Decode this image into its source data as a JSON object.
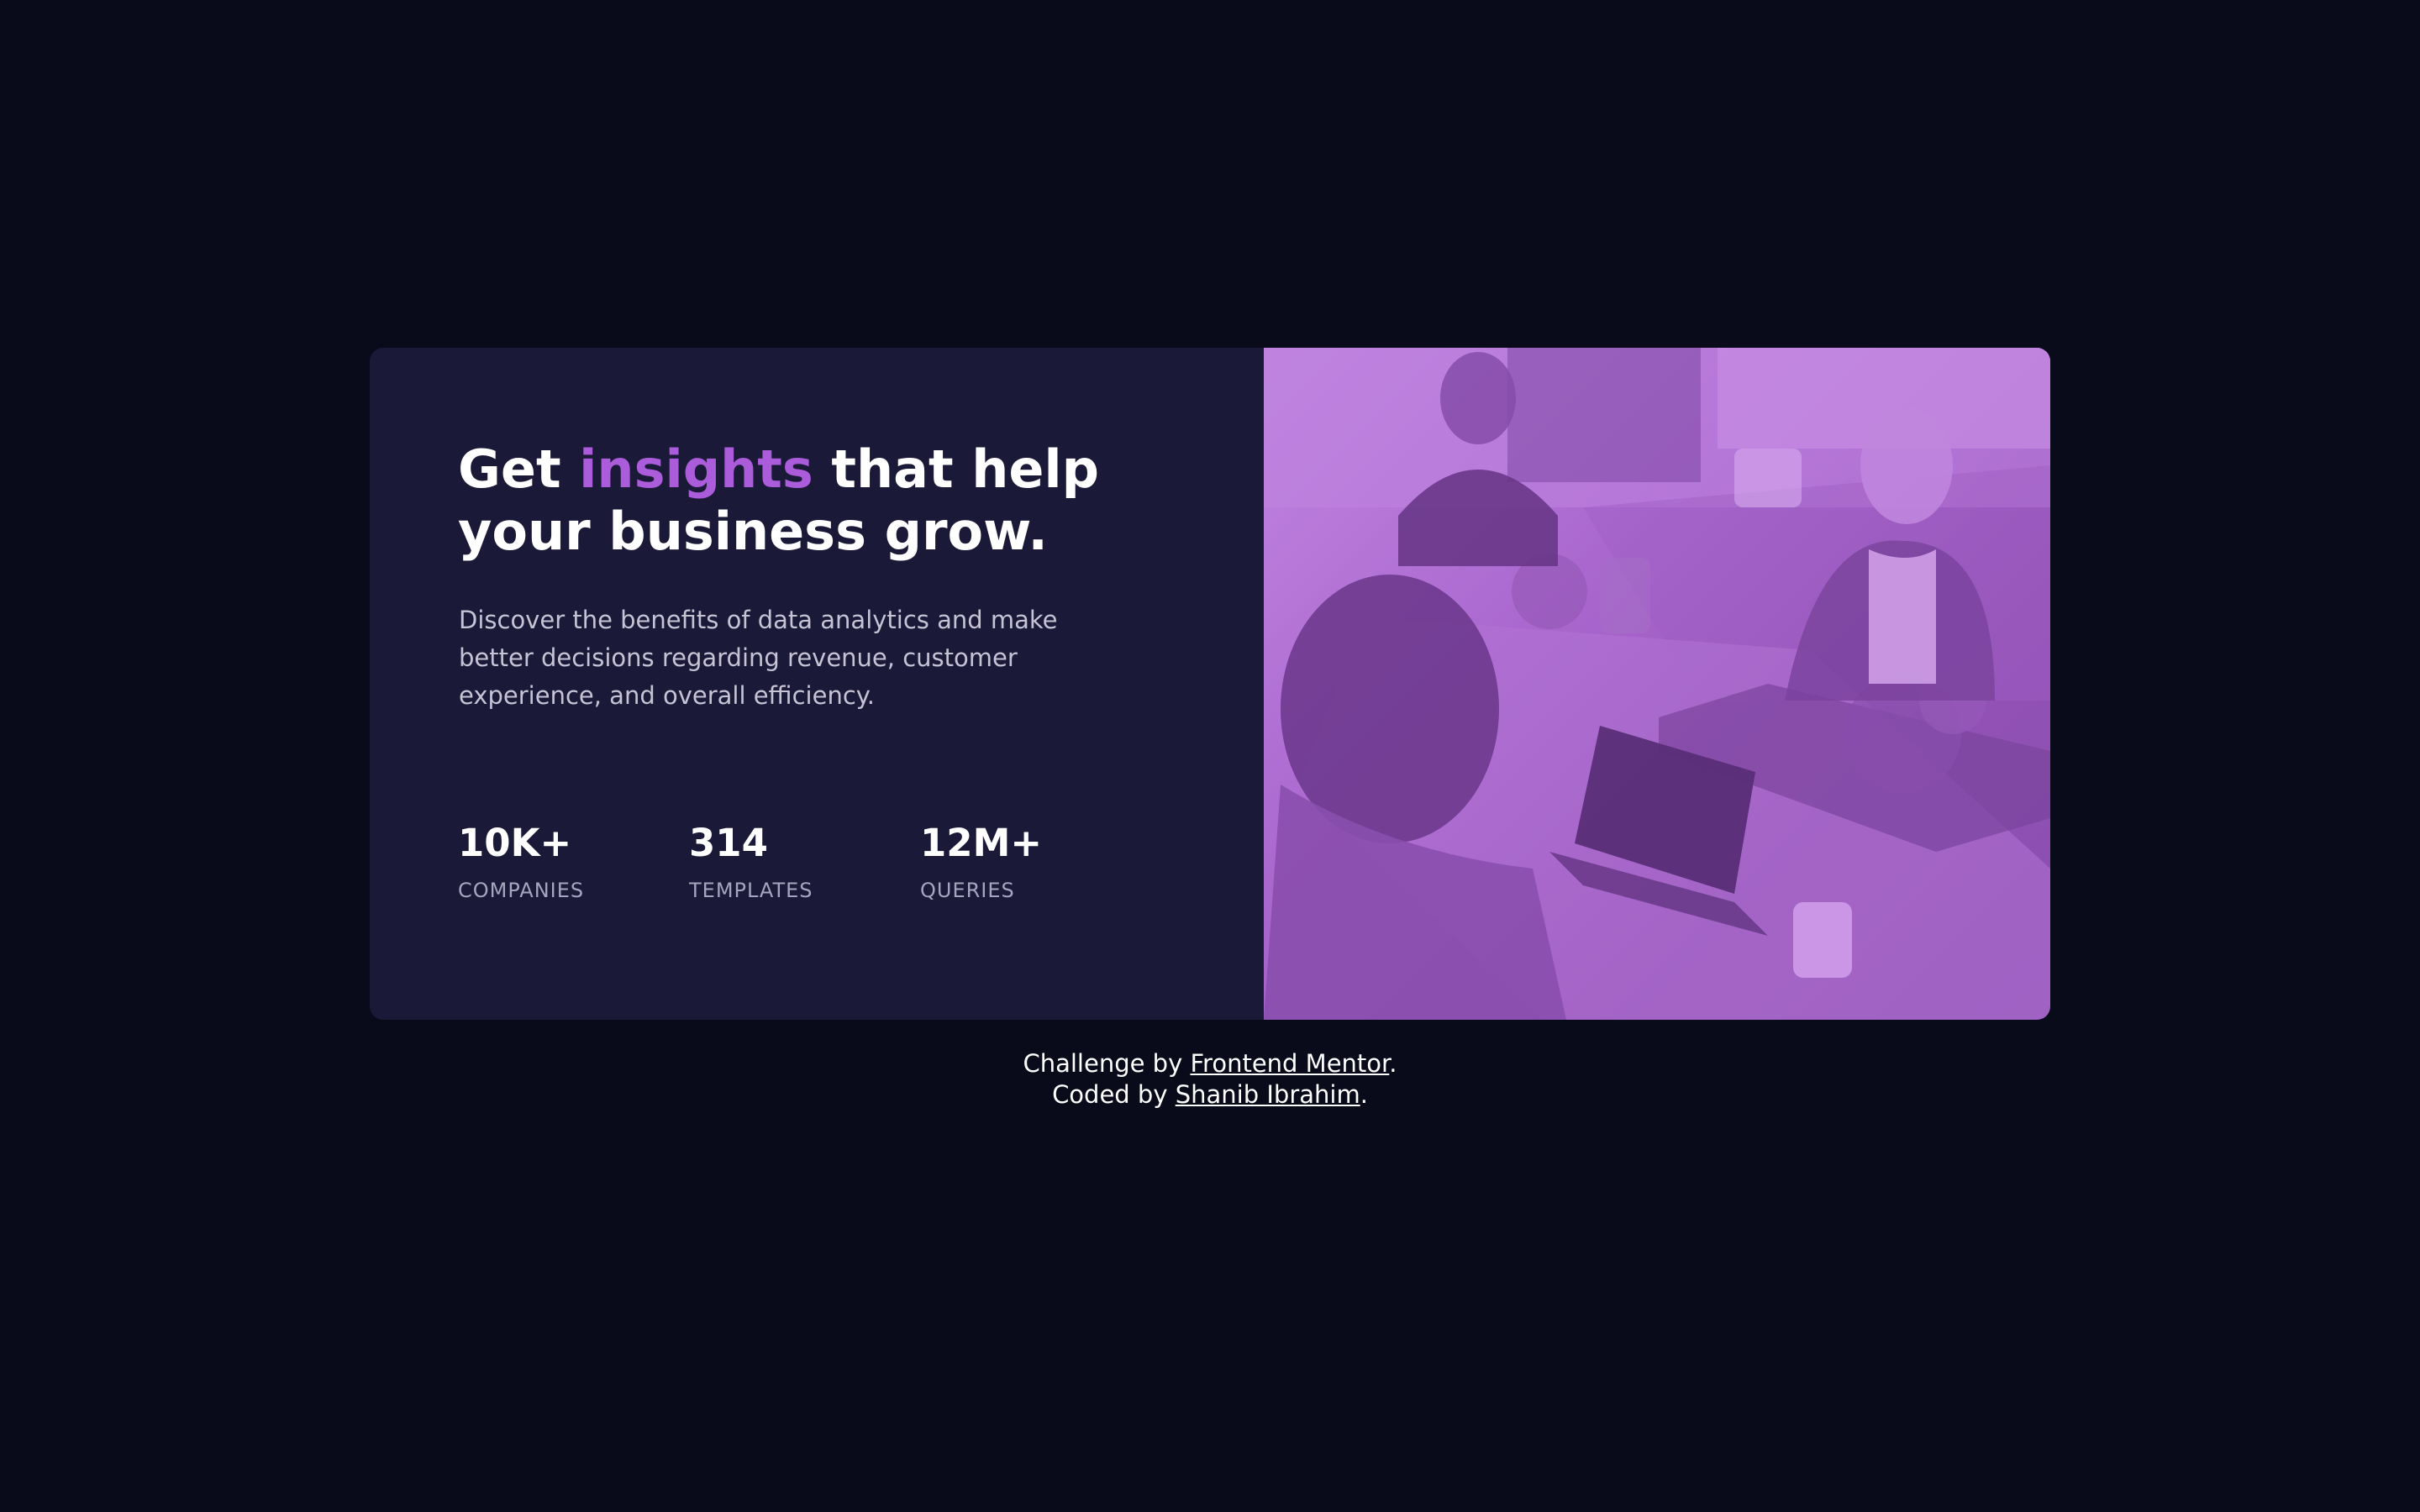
{
  "card": {
    "headline": {
      "before": "Get ",
      "accent": "insights",
      "after": " that help your business grow."
    },
    "description": "Discover the benefits of data analytics and make better decisions regarding revenue, customer experience, and overall efficiency.",
    "stats": [
      {
        "value": "10K+",
        "label": "COMPANIES"
      },
      {
        "value": "314",
        "label": "TEMPLATES"
      },
      {
        "value": "12M+",
        "label": "QUERIES"
      }
    ]
  },
  "attribution": {
    "line1_prefix": "Challenge by ",
    "line1_link": "Frontend Mentor",
    "line1_suffix": ".",
    "line2_prefix": "Coded by ",
    "line2_link": "Shanib Ibrahim",
    "line2_suffix": "."
  },
  "colors": {
    "page_background": "#090b1a",
    "card_background": "#1b1938",
    "accent": "#aa5cdb",
    "image_tint": "#aa5cdb"
  }
}
